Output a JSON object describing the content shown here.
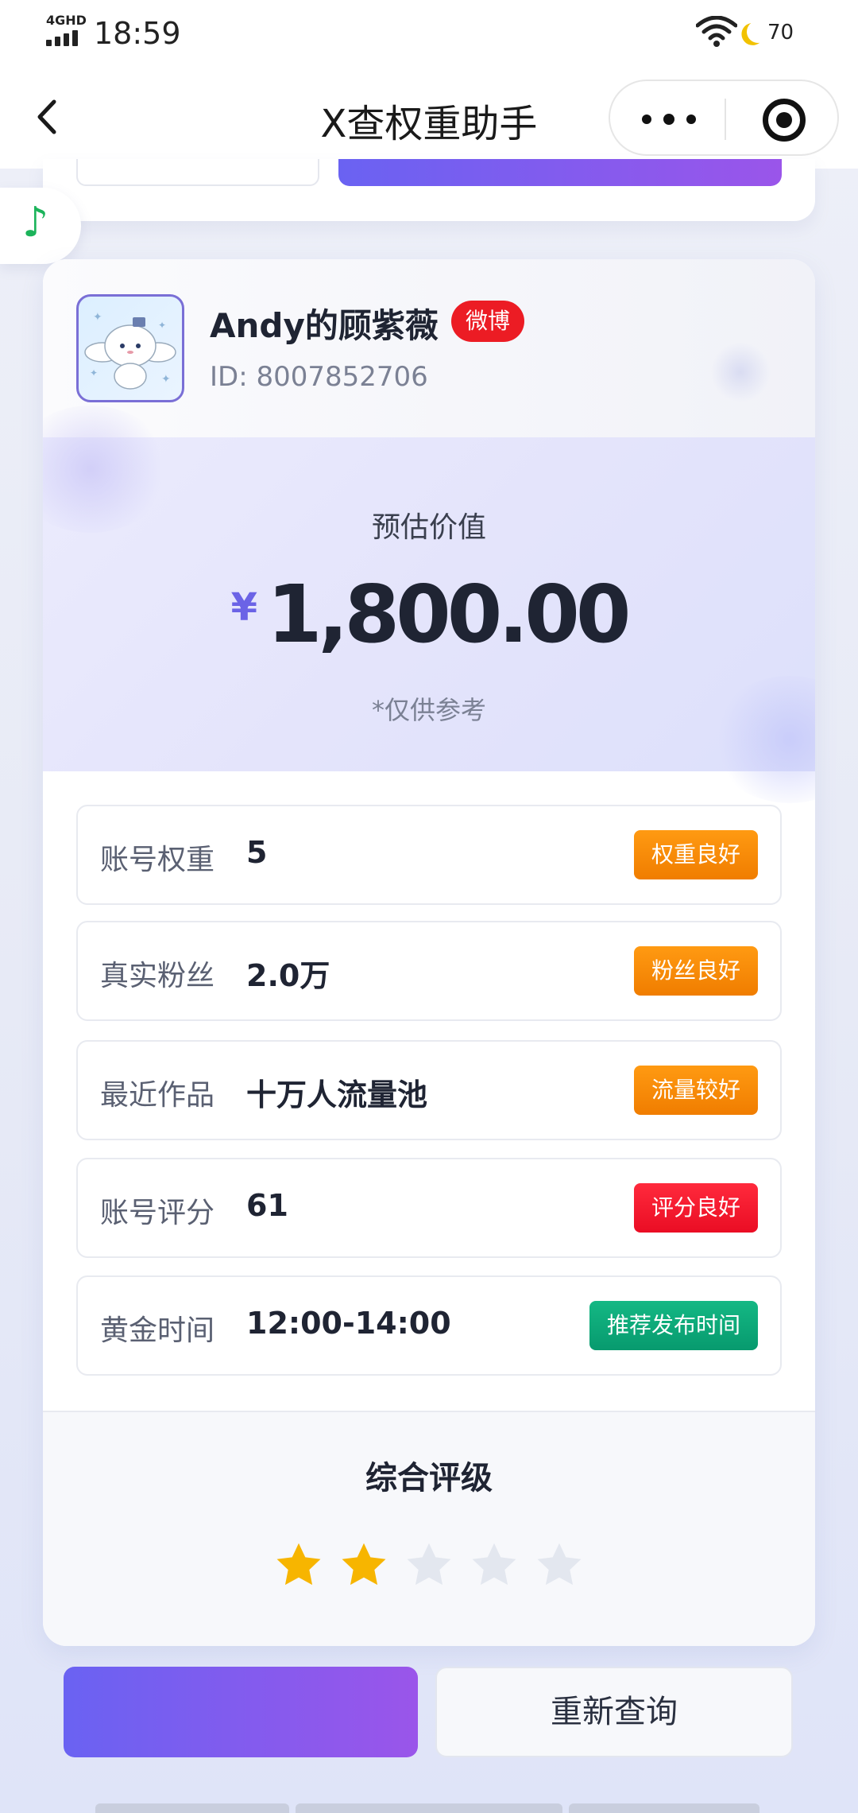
{
  "status_bar": {
    "network": "4GHD",
    "time": "18:59",
    "battery": "70"
  },
  "nav": {
    "title": "X查权重助手"
  },
  "profile": {
    "name": "Andy的顾紫薇",
    "platform": "微博",
    "id": "ID: 8007852706"
  },
  "valuation": {
    "label": "预估价值",
    "currency": "¥",
    "amount": "1,800.00",
    "note": "*仅供参考"
  },
  "metrics": [
    {
      "label": "账号权重",
      "value": "5",
      "tag": "权重良好",
      "tag_color": "#f28a00"
    },
    {
      "label": "真实粉丝",
      "value": "2.0万",
      "tag": "粉丝良好",
      "tag_color": "#f28a00"
    },
    {
      "label": "最近作品",
      "value": "十万人流量池",
      "tag": "流量较好",
      "tag_color": "#f28a00"
    },
    {
      "label": "账号评分",
      "value": "61",
      "tag": "评分良好",
      "tag_color": "#ec1530"
    },
    {
      "label": "黄金时间",
      "value": "12:00-14:00",
      "tag": "推荐发布时间",
      "tag_color": "#0ea878"
    }
  ],
  "rating": {
    "title": "综合评级",
    "stars": 2,
    "max_stars": 5
  },
  "buttons": {
    "primary": "",
    "secondary": "重新查询"
  },
  "colors": {
    "accent": "#6b63e6",
    "star_on": "#f7b500",
    "star_off": "#e3e7ef",
    "music": "#1bb35a"
  }
}
